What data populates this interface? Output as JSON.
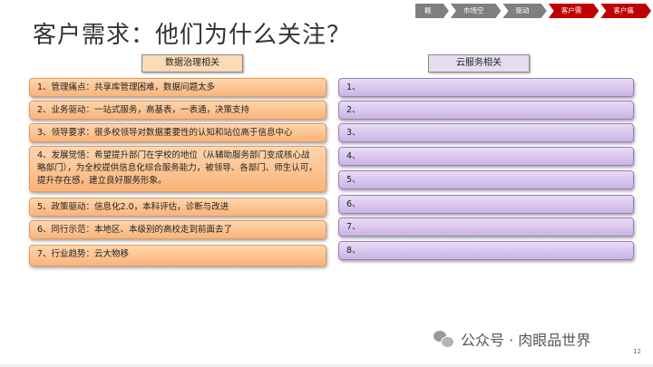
{
  "title": "客户需求：他们为什么关注？",
  "nav": [
    "概念",
    "市场空间",
    "驱动力",
    "客户需求",
    "客户痛点"
  ],
  "nav_active_color": "#c00000",
  "left_header": "数据治理相关",
  "right_header": "云服务相关",
  "left_items": [
    "1、管理痛点：共享库管理困难，数据问题太多",
    "2、业务驱动：一站式服务，高基表，一表通，决策支持",
    "3、领导要求：很多校领导对数据重要性的认知和站位高于信息中心",
    "4、发展觉悟：希望提升部门在学校的地位（从辅助服务部门变成核心战略部门），为全校提供信息化综合服务能力，被领导、各部门、师生认可，提升存在感，建立良好服务形象。",
    "5、政策驱动：信息化2.0，本科评估，诊断与改进",
    "6、同行示范：本地区、本级别的高校走到前面去了",
    "7、行业趋势：云大物移"
  ],
  "right_items": [
    "1、",
    "2、",
    "3、",
    "4、",
    "5、",
    "6、",
    "7、",
    "8、"
  ],
  "watermark": "公众号 · 肉眼品世界",
  "page_number": "12"
}
